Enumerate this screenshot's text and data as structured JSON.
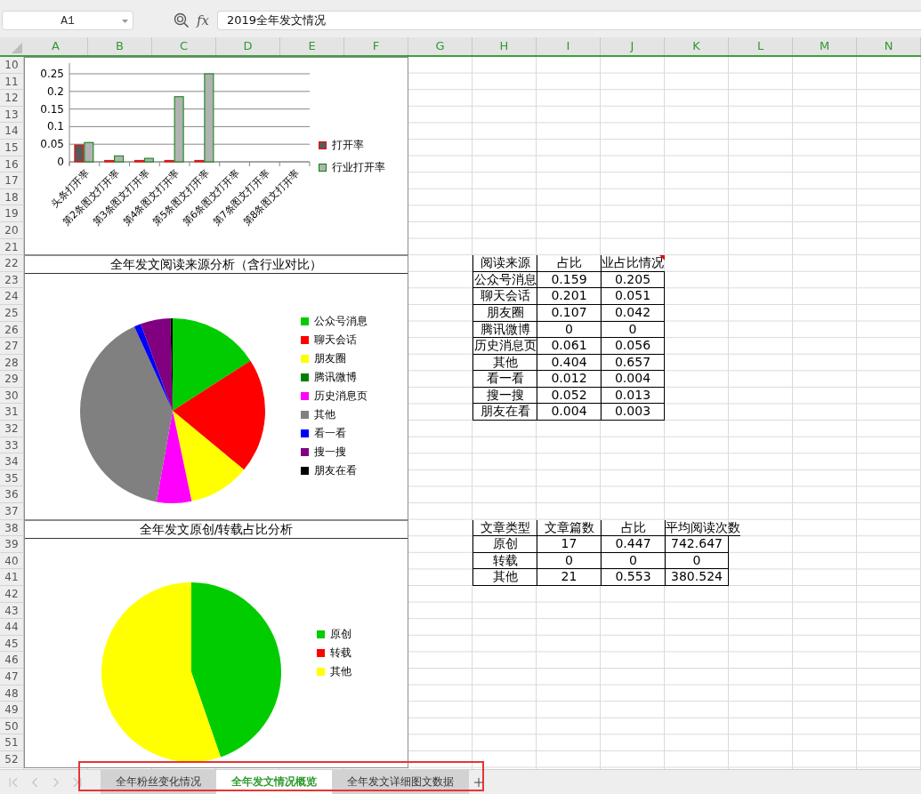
{
  "name_box": "A1",
  "formula_label": "fx",
  "formula": "2019全年发文情况",
  "columns": [
    "A",
    "B",
    "C",
    "D",
    "E",
    "F",
    "G",
    "H",
    "I",
    "J",
    "K",
    "L",
    "M",
    "N"
  ],
  "row_numbers": [
    "10",
    "11",
    "12",
    "13",
    "14",
    "15",
    "16",
    "17",
    "18",
    "19",
    "20",
    "21",
    "22",
    "23",
    "24",
    "25",
    "26",
    "27",
    "28",
    "29",
    "30",
    "31",
    "32",
    "33",
    "34",
    "35",
    "36",
    "37",
    "38",
    "39",
    "40",
    "41",
    "42",
    "43",
    "44",
    "45",
    "46",
    "47",
    "48",
    "49",
    "50",
    "51",
    "52"
  ],
  "open_rate_chart": {
    "chart_data": {
      "type": "bar",
      "categories": [
        "头条打开率",
        "第2条图文打开率",
        "第3条图文打开率",
        "第4条图文打开率",
        "第5条图文打开率",
        "第6条图文打开率",
        "第7条图文打开率",
        "第8条图文打开率"
      ],
      "series": [
        {
          "name": "打开率",
          "color": "#595959",
          "values": [
            0.048,
            0.004,
            0.004,
            0.004,
            0.004,
            0,
            0,
            0
          ]
        },
        {
          "name": "行业打开率",
          "color": "#b2b2b2",
          "values": [
            0.055,
            0.017,
            0.01,
            0.185,
            0.25,
            0,
            0,
            0
          ]
        }
      ],
      "grid": true,
      "ylim": [
        0,
        0.25
      ],
      "yticks": [
        {
          "value": 0,
          "label": "0"
        },
        {
          "value": 0.05,
          "label": "0.05"
        },
        {
          "value": 0.1,
          "label": "0.1"
        },
        {
          "value": 0.15,
          "label": "0.15"
        },
        {
          "value": 0.2,
          "label": "0.2"
        },
        {
          "value": 0.25,
          "label": "0.25"
        }
      ]
    }
  },
  "source_chart": {
    "chart_data": {
      "type": "pie",
      "title": "全年发文阅读来源分析（含行业对比）",
      "categories": [
        "公众号消息",
        "聊天会话",
        "朋友圈",
        "腾讯微博",
        "历史消息页",
        "其他",
        "看一看",
        "搜一搜",
        "朋友在看"
      ],
      "values": [
        0.159,
        0.201,
        0.107,
        0,
        0.061,
        0.404,
        0.012,
        0.052,
        0.004
      ],
      "colors": [
        "#00cc00",
        "#ff0000",
        "#ffff00",
        "#008000",
        "#ff00ff",
        "#808080",
        "#0000ff",
        "#800080",
        "#000000"
      ]
    }
  },
  "original_chart": {
    "chart_data": {
      "type": "pie",
      "title": "全年发文原创/转载占比分析",
      "categories": [
        "原创",
        "转载",
        "其他"
      ],
      "values": [
        0.447,
        0,
        0.553
      ],
      "colors": [
        "#00cc00",
        "#ff0000",
        "#ffff00"
      ]
    }
  },
  "source_table": {
    "headers": [
      {
        "label": "阅读来源",
        "comment": false
      },
      {
        "label": "占比",
        "comment": false
      },
      {
        "label": "业占比情况",
        "comment": true
      }
    ],
    "rows": [
      [
        "公众号消息",
        "0.159",
        "0.205"
      ],
      [
        "聊天会话",
        "0.201",
        "0.051"
      ],
      [
        "朋友圈",
        "0.107",
        "0.042"
      ],
      [
        "腾讯微博",
        "0",
        "0"
      ],
      [
        "历史消息页",
        "0.061",
        "0.056"
      ],
      [
        "其他",
        "0.404",
        "0.657"
      ],
      [
        "看一看",
        "0.012",
        "0.004"
      ],
      [
        "搜一搜",
        "0.052",
        "0.013"
      ],
      [
        "朋友在看",
        "0.004",
        "0.003"
      ]
    ]
  },
  "type_table": {
    "headers": [
      {
        "label": "文章类型",
        "comment": false
      },
      {
        "label": "文章篇数",
        "comment": false
      },
      {
        "label": "占比",
        "comment": false
      },
      {
        "label": "平均阅读次数",
        "comment": false
      }
    ],
    "rows": [
      [
        "原创",
        "17",
        "0.447",
        "742.647"
      ],
      [
        "转载",
        "0",
        "0",
        "0"
      ],
      [
        "其他",
        "21",
        "0.553",
        "380.524"
      ]
    ]
  },
  "sheet_tabs": [
    {
      "label": "全年粉丝变化情况",
      "selected": false
    },
    {
      "label": "全年发文情况概览",
      "selected": true
    },
    {
      "label": "全年发文详细图文数据",
      "selected": false
    }
  ]
}
